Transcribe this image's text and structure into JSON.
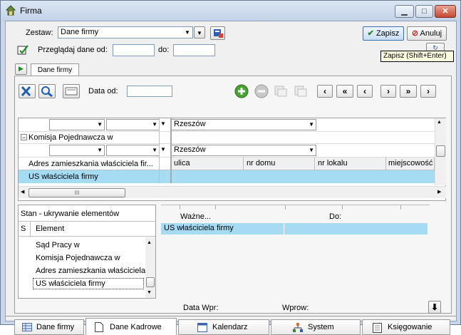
{
  "window": {
    "title": "Firma",
    "min": "▁",
    "max": "□",
    "close": "✕"
  },
  "header": {
    "zestaw_label": "Zestaw:",
    "zestaw_value": "Dane firmy",
    "przegladaj_label": "Przeglądaj dane od:",
    "do_label": "do:",
    "save_label": "Zapisz",
    "cancel_label": "Anuluj",
    "tooltip": "Zapisz (Shift+Enter)",
    "tab_label": "Dane firmy"
  },
  "toolbar": {
    "data_od_label": "Data od:"
  },
  "grid": {
    "row1_city": "Rzeszów",
    "komisja_label": "Komisja Pojednawcza w",
    "row2_city": "Rzeszów",
    "adres_label": "Adres zamieszkania właściciela fir...",
    "col_ulica": "ulica",
    "col_nr_domu": "nr domu",
    "col_nr_lokalu": "nr lokalu",
    "col_miejscowosc": "miejscowość",
    "us_label": "US właściciela firmy",
    "scroll_thumb": "III"
  },
  "lower": {
    "stan_label": "Stan - ukrywanie elementów",
    "col_s": "S",
    "col_element": "Element",
    "items": [
      "Sąd Pracy w",
      "Komisja Pojednawcza w",
      "Adres zamieszkania właściciela",
      "US właściciela firmy"
    ],
    "wazne_label": "Ważne...",
    "do_label": "Do:",
    "selected_row": "US właściciela firmy",
    "data_wpr_label": "Data Wpr:",
    "wprow_label": "Wprow:"
  },
  "bottom_tabs": [
    "Dane firmy",
    "Dane Kadrowe",
    "Kalendarz",
    "System",
    "Księgowanie"
  ],
  "colors": {
    "accent_selected": "#a6dcf3",
    "title_bg": "#c8d6e8"
  }
}
